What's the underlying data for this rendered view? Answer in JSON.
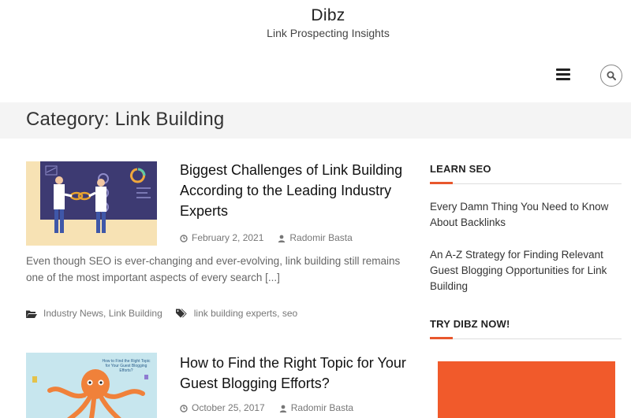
{
  "site": {
    "title": "Dibz",
    "tagline": "Link Prospecting Insights"
  },
  "header": {
    "menu_icon": "hamburger-menu-icon",
    "search_icon": "search-icon"
  },
  "category": {
    "title": "Category: Link Building"
  },
  "posts": [
    {
      "title": "Biggest Challenges of Link Building According to the Leading Industry Experts",
      "date": "February 2, 2021",
      "author": "Radomir Basta",
      "excerpt": "Even though SEO is ever-changing and ever-evolving, link building still remains one of the most important aspects of every search [...]",
      "categories": [
        "Industry News",
        "Link Building"
      ],
      "tags": [
        "link building experts",
        "seo"
      ]
    },
    {
      "title": "How to Find the Right Topic for Your Guest Blogging Efforts?",
      "date": "October 25, 2017",
      "author": "Radomir Basta",
      "thumb_text": "How to Find the Right Topic for Your Guest Blogging Efforts?"
    }
  ],
  "sidebar": {
    "learn_seo": {
      "title": "LEARN SEO",
      "links": [
        "Every Damn Thing You Need to Know About Backlinks",
        "An A-Z Strategy for Finding Relevant Guest Blogging Opportunities for Link Building"
      ]
    },
    "try_dibz": {
      "title": "TRY DIBZ NOW!"
    }
  },
  "colors": {
    "accent": "#e8572d",
    "promo": "#f15a2b",
    "category_bar": "#f4f4f4"
  }
}
